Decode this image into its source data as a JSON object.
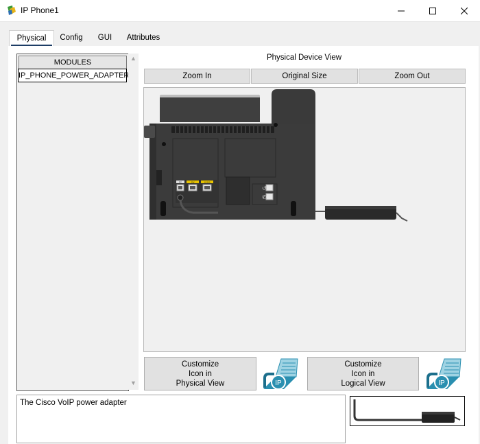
{
  "window": {
    "title": "IP Phone1",
    "icons": {
      "app": "packet-tracer-icon",
      "minimize": "minimize-icon",
      "maximize": "maximize-icon",
      "close": "close-icon"
    }
  },
  "tabs": [
    {
      "label": "Physical",
      "active": true
    },
    {
      "label": "Config",
      "active": false
    },
    {
      "label": "GUI",
      "active": false
    },
    {
      "label": "Attributes",
      "active": false
    }
  ],
  "modules": {
    "header": "MODULES",
    "items": [
      "IP_PHONE_POWER_ADAPTER"
    ]
  },
  "device_view": {
    "title": "Physical Device View",
    "zoom_in": "Zoom In",
    "original_size": "Original Size",
    "zoom_out": "Zoom Out",
    "port_labels": [
      "PC",
      "SW",
      "10/100"
    ]
  },
  "customize": {
    "physical": [
      "Customize",
      "Icon in",
      "Physical View"
    ],
    "logical": [
      "Customize",
      "Icon in",
      "Logical View"
    ],
    "icon_label": "IP"
  },
  "description": "The Cisco VoIP power adapter",
  "colors": {
    "accent": "#1d3d66",
    "phone_body": "#3b3b3b",
    "icon_teal": "#2a8fb0"
  }
}
